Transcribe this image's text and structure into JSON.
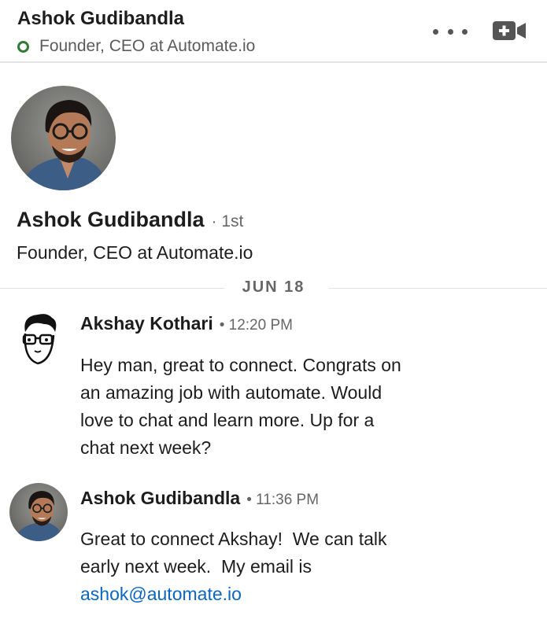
{
  "header": {
    "name": "Ashok Gudibandla",
    "headline": "Founder, CEO at Automate.io",
    "status_color": "#2e7d32",
    "more_icon": "more-horizontal-icon",
    "video_icon": "video-call-icon"
  },
  "profile": {
    "name": "Ashok Gudibandla",
    "degree": "· 1st",
    "headline": "Founder, CEO at Automate.io"
  },
  "date_separator": "JUN 18",
  "messages": [
    {
      "sender": "Akshay Kothari",
      "time": "• 12:20 PM",
      "lines": [
        "Hey man, great to connect. Congrats on",
        "an amazing job with automate. Would",
        "love to chat and learn more. Up for a",
        "chat next week?"
      ]
    },
    {
      "sender": "Ashok Gudibandla",
      "time": "• 11:36 PM",
      "lines": [
        "Great to connect Akshay!  We can talk",
        "early next week.  My email is"
      ],
      "email": "ashok@automate.io"
    }
  ],
  "colors": {
    "link": "#0a66c2",
    "online": "#2e7d32"
  }
}
